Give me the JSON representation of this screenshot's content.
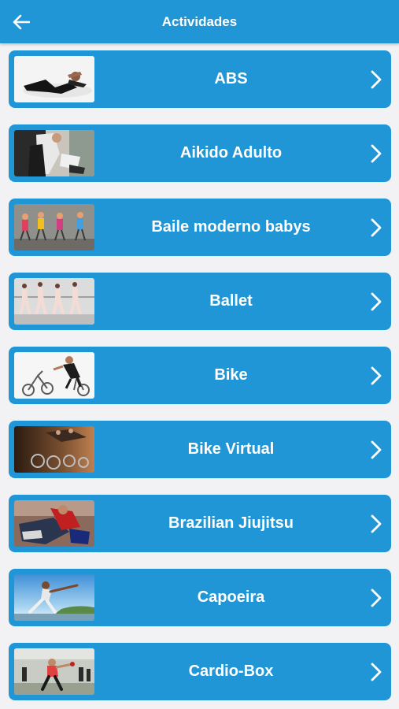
{
  "header": {
    "title": "Actividades",
    "back_icon": "arrow-left-icon"
  },
  "colors": {
    "primary": "#2196d6",
    "background": "#f2f2f4",
    "text": "#ffffff"
  },
  "activities": [
    {
      "label": "ABS",
      "icon": "chevron-right-icon"
    },
    {
      "label": "Aikido Adulto",
      "icon": "chevron-right-icon"
    },
    {
      "label": "Baile moderno babys",
      "icon": "chevron-right-icon"
    },
    {
      "label": "Ballet",
      "icon": "chevron-right-icon"
    },
    {
      "label": "Bike",
      "icon": "chevron-right-icon"
    },
    {
      "label": "Bike Virtual",
      "icon": "chevron-right-icon"
    },
    {
      "label": "Brazilian Jiujitsu",
      "icon": "chevron-right-icon"
    },
    {
      "label": "Capoeira",
      "icon": "chevron-right-icon"
    },
    {
      "label": "Cardio-Box",
      "icon": "chevron-right-icon"
    }
  ]
}
